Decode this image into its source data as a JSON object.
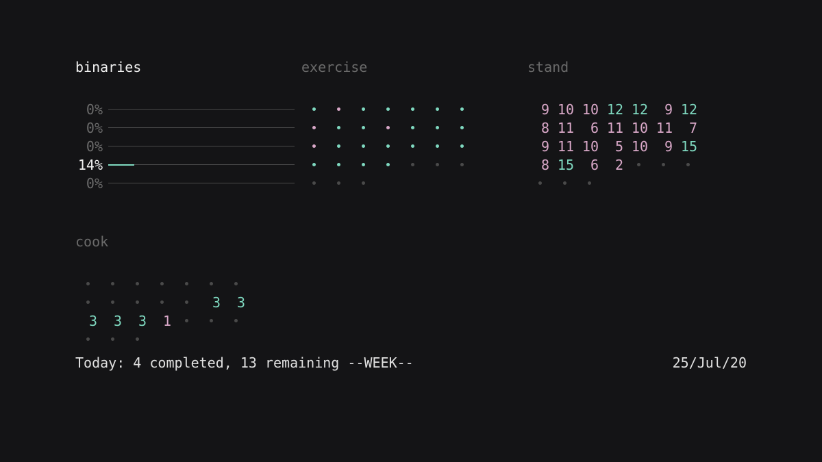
{
  "sections": {
    "binaries": {
      "title": "binaries",
      "active": true,
      "rows": [
        {
          "pct": 0,
          "active": false
        },
        {
          "pct": 0,
          "active": false
        },
        {
          "pct": 0,
          "active": false
        },
        {
          "pct": 14,
          "active": true
        },
        {
          "pct": 0,
          "active": false
        }
      ]
    },
    "exercise": {
      "title": "exercise",
      "active": false,
      "cols": 7,
      "cells": [
        "teal",
        "pink",
        "teal",
        "teal",
        "teal",
        "teal",
        "teal",
        "pink",
        "teal",
        "teal",
        "pink",
        "teal",
        "teal",
        "teal",
        "pink",
        "teal",
        "teal",
        "teal",
        "teal",
        "teal",
        "teal",
        "teal",
        "teal",
        "teal",
        "teal",
        "mute",
        "mute",
        "mute",
        "mute",
        "mute",
        "mute"
      ]
    },
    "stand": {
      "title": "stand",
      "active": false,
      "cols": 7,
      "cells": [
        {
          "v": 9,
          "c": "pink"
        },
        {
          "v": 10,
          "c": "pink"
        },
        {
          "v": 10,
          "c": "pink"
        },
        {
          "v": 12,
          "c": "teal"
        },
        {
          "v": 12,
          "c": "teal"
        },
        {
          "v": 9,
          "c": "pink"
        },
        {
          "v": 12,
          "c": "teal"
        },
        {
          "v": 8,
          "c": "pink"
        },
        {
          "v": 11,
          "c": "pink"
        },
        {
          "v": 6,
          "c": "pink"
        },
        {
          "v": 11,
          "c": "pink"
        },
        {
          "v": 10,
          "c": "pink"
        },
        {
          "v": 11,
          "c": "pink"
        },
        {
          "v": 7,
          "c": "pink"
        },
        {
          "v": 9,
          "c": "pink"
        },
        {
          "v": 11,
          "c": "pink"
        },
        {
          "v": 10,
          "c": "pink"
        },
        {
          "v": 5,
          "c": "pink"
        },
        {
          "v": 10,
          "c": "pink"
        },
        {
          "v": 9,
          "c": "pink"
        },
        {
          "v": 15,
          "c": "teal"
        },
        {
          "v": 8,
          "c": "pink"
        },
        {
          "v": 15,
          "c": "teal"
        },
        {
          "v": 6,
          "c": "pink"
        },
        {
          "v": 2,
          "c": "pink"
        },
        {
          "v": null,
          "c": "mute"
        },
        {
          "v": null,
          "c": "mute"
        },
        {
          "v": null,
          "c": "mute"
        },
        {
          "v": null,
          "c": "mute"
        },
        {
          "v": null,
          "c": "mute"
        },
        {
          "v": null,
          "c": "mute"
        }
      ]
    },
    "cook": {
      "title": "cook",
      "active": false,
      "cols": 7,
      "cells": [
        {
          "v": null,
          "c": "mute"
        },
        {
          "v": null,
          "c": "mute"
        },
        {
          "v": null,
          "c": "mute"
        },
        {
          "v": null,
          "c": "mute"
        },
        {
          "v": null,
          "c": "mute"
        },
        {
          "v": null,
          "c": "mute"
        },
        {
          "v": null,
          "c": "mute"
        },
        {
          "v": null,
          "c": "mute"
        },
        {
          "v": null,
          "c": "mute"
        },
        {
          "v": null,
          "c": "mute"
        },
        {
          "v": null,
          "c": "mute"
        },
        {
          "v": null,
          "c": "mute"
        },
        {
          "v": 3,
          "c": "teal"
        },
        {
          "v": 3,
          "c": "teal"
        },
        {
          "v": 3,
          "c": "teal"
        },
        {
          "v": 3,
          "c": "teal"
        },
        {
          "v": 3,
          "c": "teal"
        },
        {
          "v": 1,
          "c": "pink"
        },
        {
          "v": null,
          "c": "mute"
        },
        {
          "v": null,
          "c": "mute"
        },
        {
          "v": null,
          "c": "mute"
        },
        {
          "v": null,
          "c": "mute"
        },
        {
          "v": null,
          "c": "mute"
        },
        {
          "v": null,
          "c": "mute"
        }
      ]
    }
  },
  "footer": {
    "today_prefix": "Today: ",
    "completed": 4,
    "completed_word": " completed, ",
    "remaining": 13,
    "remaining_word": " remaining ",
    "mode": "--WEEK--",
    "date": "25/Jul/20"
  },
  "colors": {
    "teal": "#7fd9c0",
    "pink": "#d9a8c8",
    "mute": "#4a4a4a"
  }
}
